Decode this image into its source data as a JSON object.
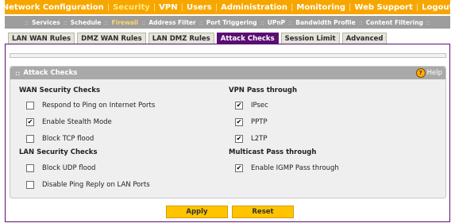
{
  "top_menu": {
    "items": [
      {
        "label": "Network Configuration",
        "active": false
      },
      {
        "label": "Security",
        "active": true
      },
      {
        "label": "VPN",
        "active": false
      },
      {
        "label": "Users",
        "active": false
      },
      {
        "label": "Administration",
        "active": false
      },
      {
        "label": "Monitoring",
        "active": false
      },
      {
        "label": "Web Support",
        "active": false
      },
      {
        "label": "Logout",
        "active": false
      }
    ],
    "separator": "|"
  },
  "sub_menu": {
    "items": [
      {
        "label": "Services",
        "active": false
      },
      {
        "label": "Schedule",
        "active": false
      },
      {
        "label": "Firewall",
        "active": true
      },
      {
        "label": "Address Filter",
        "active": false
      },
      {
        "label": "Port Triggering",
        "active": false
      },
      {
        "label": "UPnP",
        "active": false
      },
      {
        "label": "Bandwidth Profile",
        "active": false
      },
      {
        "label": "Content Filtering",
        "active": false
      }
    ],
    "separator": "::"
  },
  "tabs": [
    {
      "label": "LAN WAN Rules",
      "active": false
    },
    {
      "label": "DMZ WAN Rules",
      "active": false
    },
    {
      "label": "LAN DMZ Rules",
      "active": false
    },
    {
      "label": "Attack Checks",
      "active": true
    },
    {
      "label": "Session Limit",
      "active": false
    },
    {
      "label": "Advanced",
      "active": false
    }
  ],
  "panel": {
    "title": "Attack Checks",
    "grip": "::",
    "help_label": "Help",
    "help_icon": "?"
  },
  "wan_security": {
    "title": "WAN Security Checks",
    "options": [
      {
        "label": "Respond to Ping on Internet Ports",
        "checked": false
      },
      {
        "label": "Enable Stealth Mode",
        "checked": true
      },
      {
        "label": "Block TCP flood",
        "checked": false
      }
    ]
  },
  "lan_security": {
    "title": "LAN Security Checks",
    "options": [
      {
        "label": "Block UDP flood",
        "checked": false
      },
      {
        "label": "Disable Ping Reply on LAN Ports",
        "checked": false
      }
    ]
  },
  "vpn_pass": {
    "title": "VPN Pass through",
    "options": [
      {
        "label": "IPsec",
        "checked": true
      },
      {
        "label": "PPTP",
        "checked": true
      },
      {
        "label": "L2TP",
        "checked": true
      }
    ]
  },
  "multicast_pass": {
    "title": "Multicast Pass through",
    "options": [
      {
        "label": "Enable IGMP Pass through",
        "checked": true
      }
    ]
  },
  "buttons": {
    "apply": "Apply",
    "reset": "Reset"
  },
  "colors": {
    "top_menu_bg": "#f7a600",
    "sub_menu_bg": "#9d9d9d",
    "active_tab_bg": "#5b0e72",
    "button_bg": "#ffc400"
  }
}
